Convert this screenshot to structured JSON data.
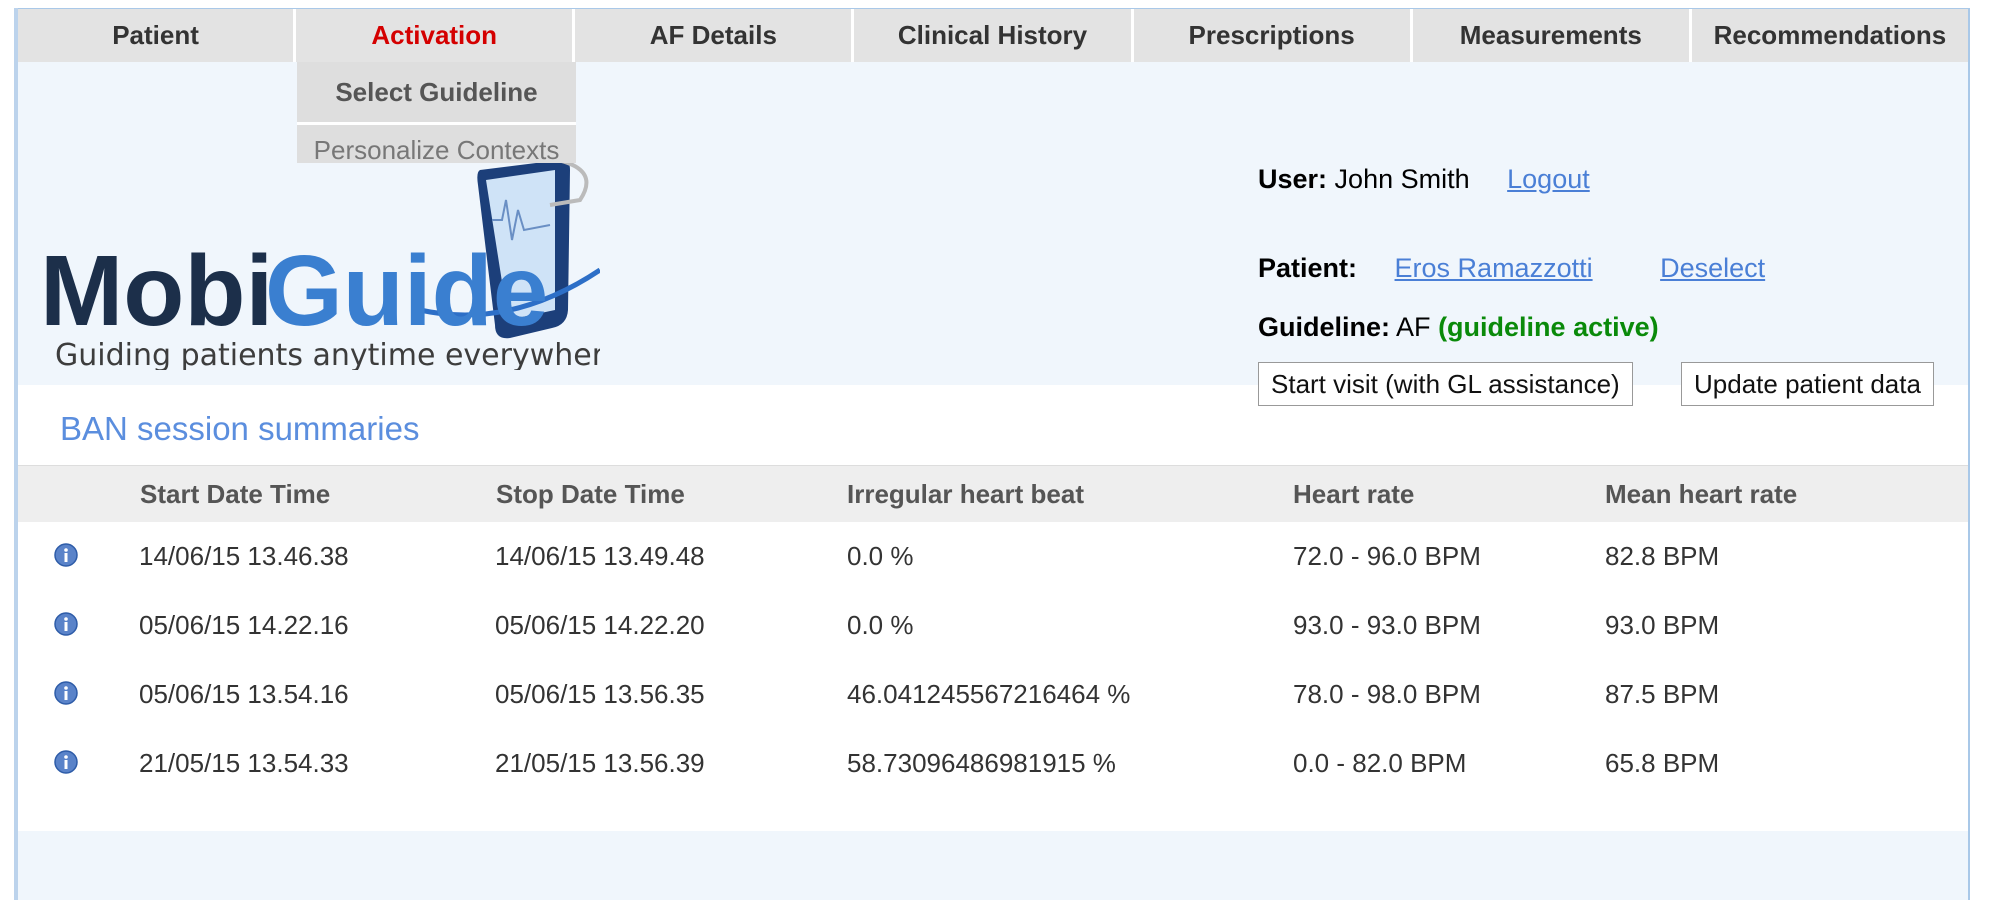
{
  "nav": {
    "tabs": [
      "Patient",
      "Activation",
      "AF Details",
      "Clinical History",
      "Prescriptions",
      "Measurements",
      "Recommendations"
    ],
    "active_index": 1,
    "dropdown": [
      "Select Guideline",
      "Personalize Contexts"
    ]
  },
  "logo": {
    "word_mobi": "Mobi",
    "word_guide": "Guide",
    "tagline": "Guiding patients anytime everywhere"
  },
  "user": {
    "label": "User:",
    "name": "John Smith",
    "logout": "Logout"
  },
  "patient": {
    "label": "Patient:",
    "name": "Eros Ramazzotti",
    "deselect": "Deselect"
  },
  "guideline": {
    "label": "Guideline:",
    "name": "AF",
    "status": "(guideline active)"
  },
  "buttons": {
    "start_visit": "Start visit (with GL assistance)",
    "update_patient": "Update patient data"
  },
  "section_title": "BAN session summaries",
  "table": {
    "headers": [
      "Start Date Time",
      "Stop Date Time",
      "Irregular heart beat",
      "Heart rate",
      "Mean heart rate"
    ],
    "rows": [
      [
        "14/06/15 13.46.38",
        "14/06/15 13.49.48",
        "0.0 %",
        "72.0 - 96.0 BPM",
        "82.8 BPM"
      ],
      [
        "05/06/15 14.22.16",
        "05/06/15 14.22.20",
        "0.0 %",
        "93.0 - 93.0 BPM",
        "93.0 BPM"
      ],
      [
        "05/06/15 13.54.16",
        "05/06/15 13.56.35",
        "46.041245567216464 %",
        "78.0 - 98.0 BPM",
        "87.5 BPM"
      ],
      [
        "21/05/15 13.54.33",
        "21/05/15 13.56.39",
        "58.73096486981915 %",
        "0.0 - 82.0 BPM",
        "65.8 BPM"
      ]
    ]
  },
  "icons": {
    "row_info": "info-icon"
  },
  "colors": {
    "active_tab": "#d40000",
    "link": "#4a7fd6",
    "status_active": "#0a8a0a",
    "section_title": "#5b8ede"
  }
}
